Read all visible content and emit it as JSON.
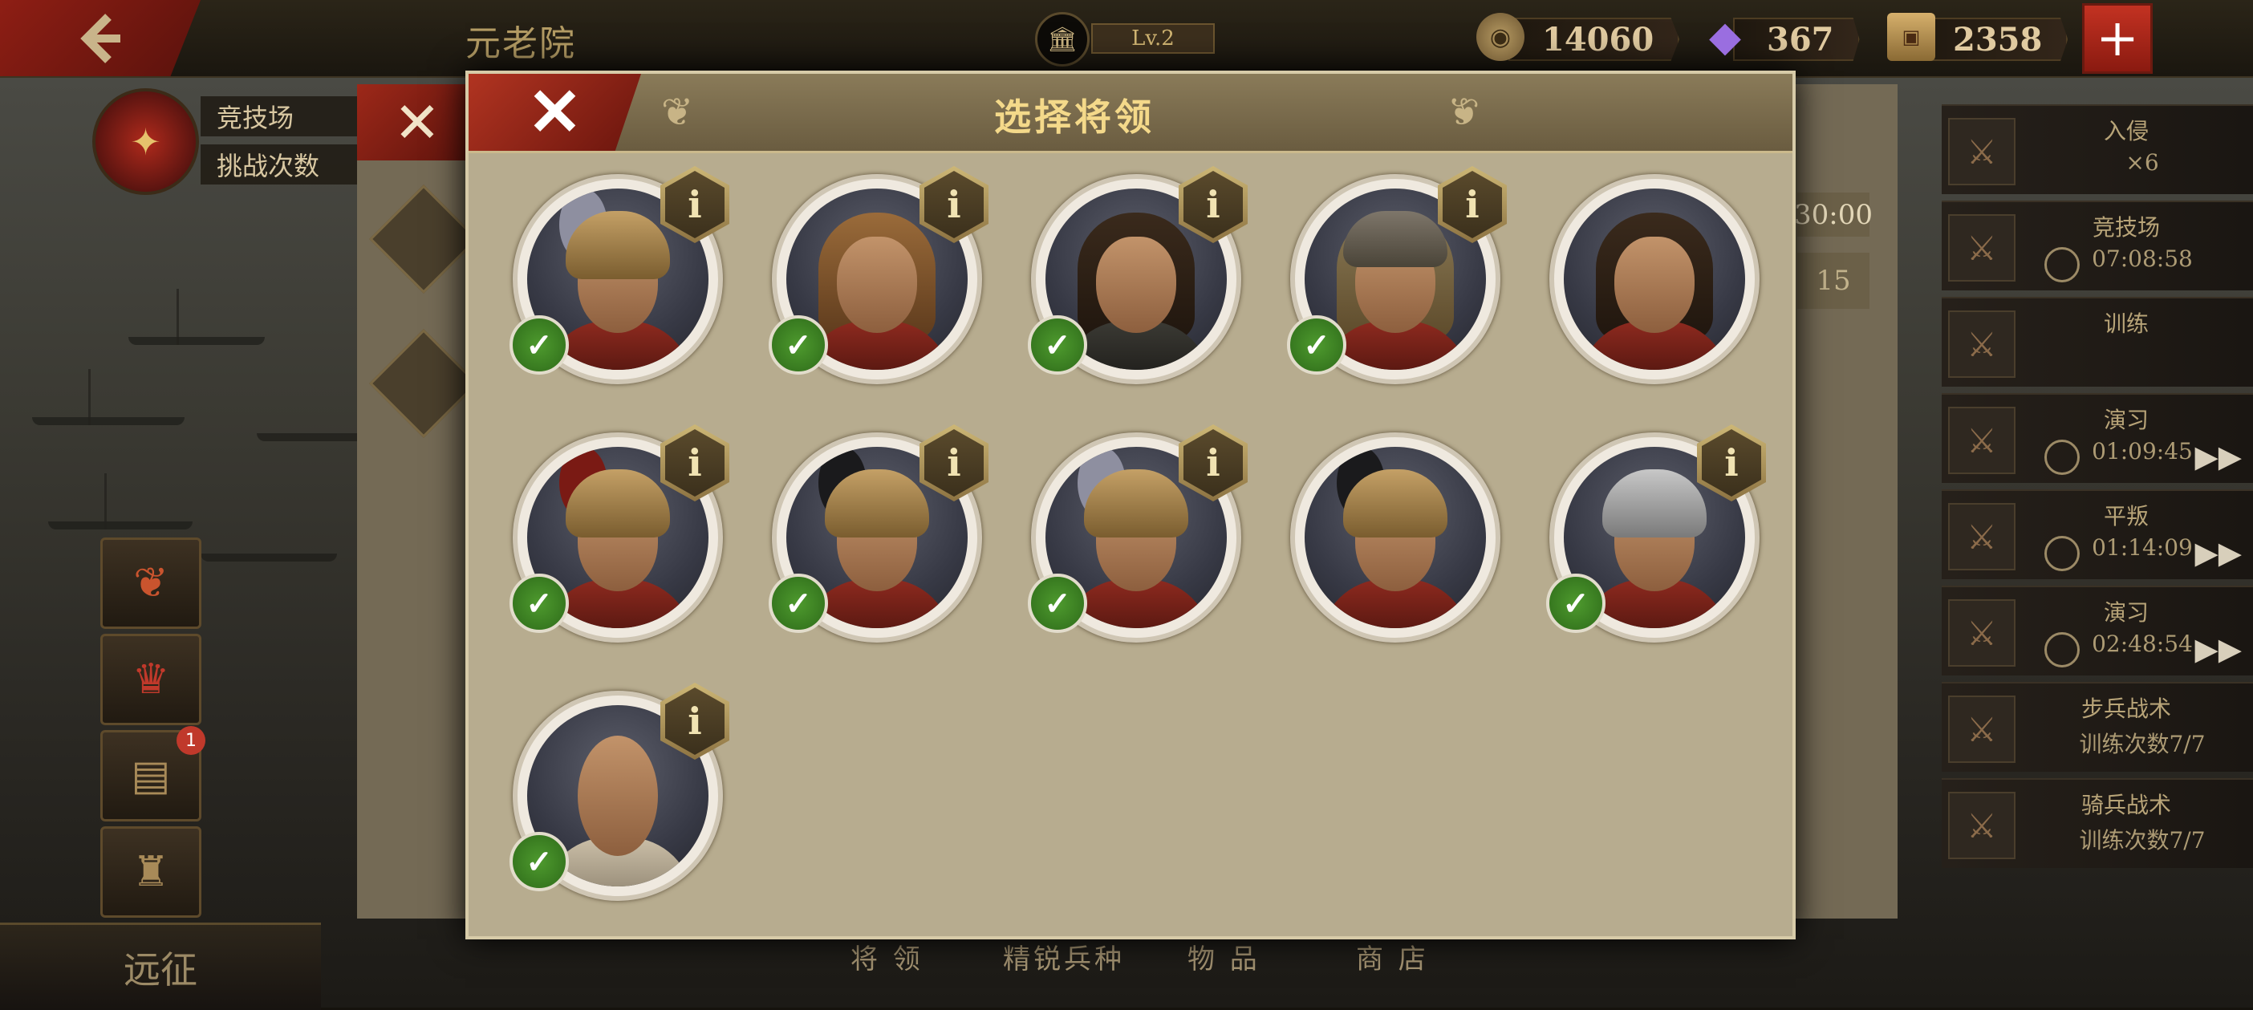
{
  "header": {
    "back_icon": "chevron-left-icon",
    "title": "元老院",
    "level": "Lv.2",
    "resources": [
      {
        "name": "coin",
        "icon": "coin-icon",
        "value": "14060"
      },
      {
        "name": "gem",
        "icon": "purple-gem-icon",
        "value": "367"
      },
      {
        "name": "ticket",
        "icon": "ticket-icon",
        "value": "2358"
      }
    ],
    "plus_label": "+"
  },
  "left": {
    "arena_label": "竞技场",
    "challenge_label": "挑战次数",
    "badge_count": "1",
    "bottom_label": "远征"
  },
  "bottom_tabs": [
    "将 领",
    "精锐兵种",
    "物 品",
    "商 店"
  ],
  "behind_panel": {
    "time": "30:00",
    "count": "15"
  },
  "right_quests": [
    {
      "title": "入侵",
      "sub": "×6",
      "icon": "invasion-icon",
      "has_clock": false,
      "has_play": false
    },
    {
      "title": "竞技场",
      "sub": "07:08:58",
      "icon": "crossed-swords-icon",
      "has_clock": true,
      "has_play": false
    },
    {
      "title": "训练",
      "sub": "",
      "icon": "helmet-icon",
      "has_clock": false,
      "has_play": false
    },
    {
      "title": "演习",
      "sub": "01:09:45",
      "icon": "drill-icon",
      "has_clock": true,
      "has_play": true
    },
    {
      "title": "平叛",
      "sub": "01:14:09",
      "icon": "mask-icon",
      "has_clock": true,
      "has_play": true
    },
    {
      "title": "演习",
      "sub": "02:48:54",
      "icon": "drill-icon",
      "has_clock": true,
      "has_play": true
    },
    {
      "title": "步兵战术",
      "sub": "训练次数7/7",
      "icon": "sword-icon",
      "has_clock": false,
      "has_play": false
    },
    {
      "title": "骑兵战术",
      "sub": "训练次数7/7",
      "icon": "horse-icon",
      "has_clock": false,
      "has_play": false
    }
  ],
  "modal": {
    "title": "选择将领",
    "close_icon": "close-icon",
    "generals": [
      {
        "type": "helmet-plume",
        "selected": true,
        "info": true
      },
      {
        "type": "lion-pelt",
        "selected": true,
        "info": true
      },
      {
        "type": "bare-dark",
        "selected": true,
        "info": true
      },
      {
        "type": "winged-helm",
        "selected": true,
        "info": true
      },
      {
        "type": "bare-beard",
        "selected": false,
        "info": false
      },
      {
        "type": "helmet-red-crest",
        "selected": true,
        "info": true
      },
      {
        "type": "helmet-black-crest",
        "selected": true,
        "info": true
      },
      {
        "type": "helmet-white-crest",
        "selected": true,
        "info": true
      },
      {
        "type": "helmet-black-crest",
        "selected": false,
        "info": false
      },
      {
        "type": "steel-helm",
        "selected": true,
        "info": true
      },
      {
        "type": "bald",
        "selected": true,
        "info": true
      }
    ],
    "check_glyph": "✓",
    "info_glyph": "i"
  },
  "colors": {
    "accent_red": "#9d2819",
    "check_green": "#3f8a26",
    "title_gold": "#f4d98a"
  }
}
